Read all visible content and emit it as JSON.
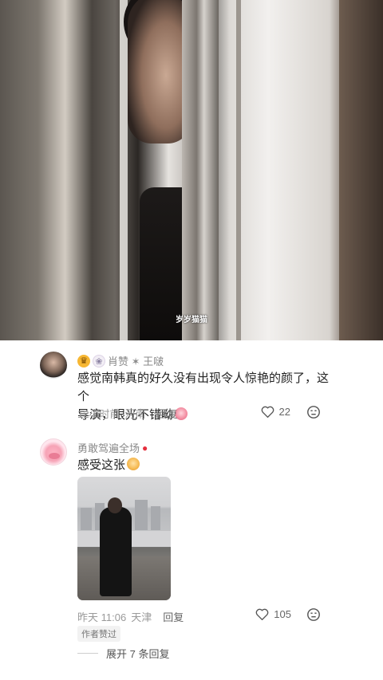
{
  "video": {
    "watermark": "岁岁猫猫"
  },
  "comments": [
    {
      "name": "肖赞 ✶ 王啵",
      "badges": [
        "lion-badge",
        "rabbit-badge"
      ],
      "text_line1": "感觉南韩真的好久没有出现令人惊艳的颜了，这个",
      "text_line2": "导演，眼光不错呦",
      "time": "12小时前",
      "location": "河南",
      "reply_label": "回复",
      "likes": "22"
    },
    {
      "name": "勇敢驾遍全场",
      "text": "感受这张",
      "time": "昨天 11:06",
      "location": "天津",
      "reply_label": "回复",
      "likes": "105",
      "author_tag": "作者赞过",
      "expand_label": "展开 7 条回复"
    }
  ],
  "colors": {
    "meta_text": "#9a9a9a",
    "body_text": "#222222",
    "name_text": "#8a8a8a"
  }
}
